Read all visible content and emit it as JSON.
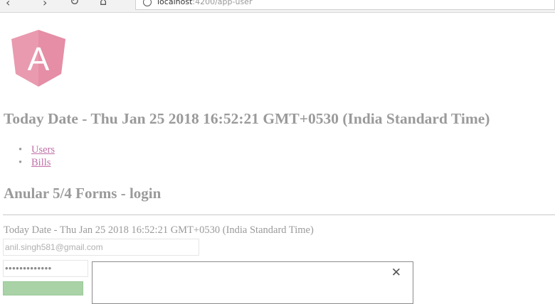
{
  "browser": {
    "address_host": "localhost",
    "address_rest": ":4200/app-user"
  },
  "header": {
    "logo_letter": "A",
    "date_heading": "Today Date - Thu Jan 25 2018 16:52:21 GMT+0530 (India Standard Time)"
  },
  "nav": {
    "items": [
      {
        "label": "Users"
      },
      {
        "label": "Bills"
      }
    ]
  },
  "form": {
    "heading": "Anular 5/4 Forms - login",
    "date_line": "Today Date - Thu Jan 25 2018 16:52:21 GMT+0530 (India Standard Time)",
    "email_value": "anil.singh581@gmail.com",
    "password_value": "•••••••••••••"
  },
  "modal": {
    "close_glyph": "✕"
  },
  "colors": {
    "link": "#c070a6",
    "logo": "#e99aaf",
    "login_button": "#a9d3a6"
  }
}
